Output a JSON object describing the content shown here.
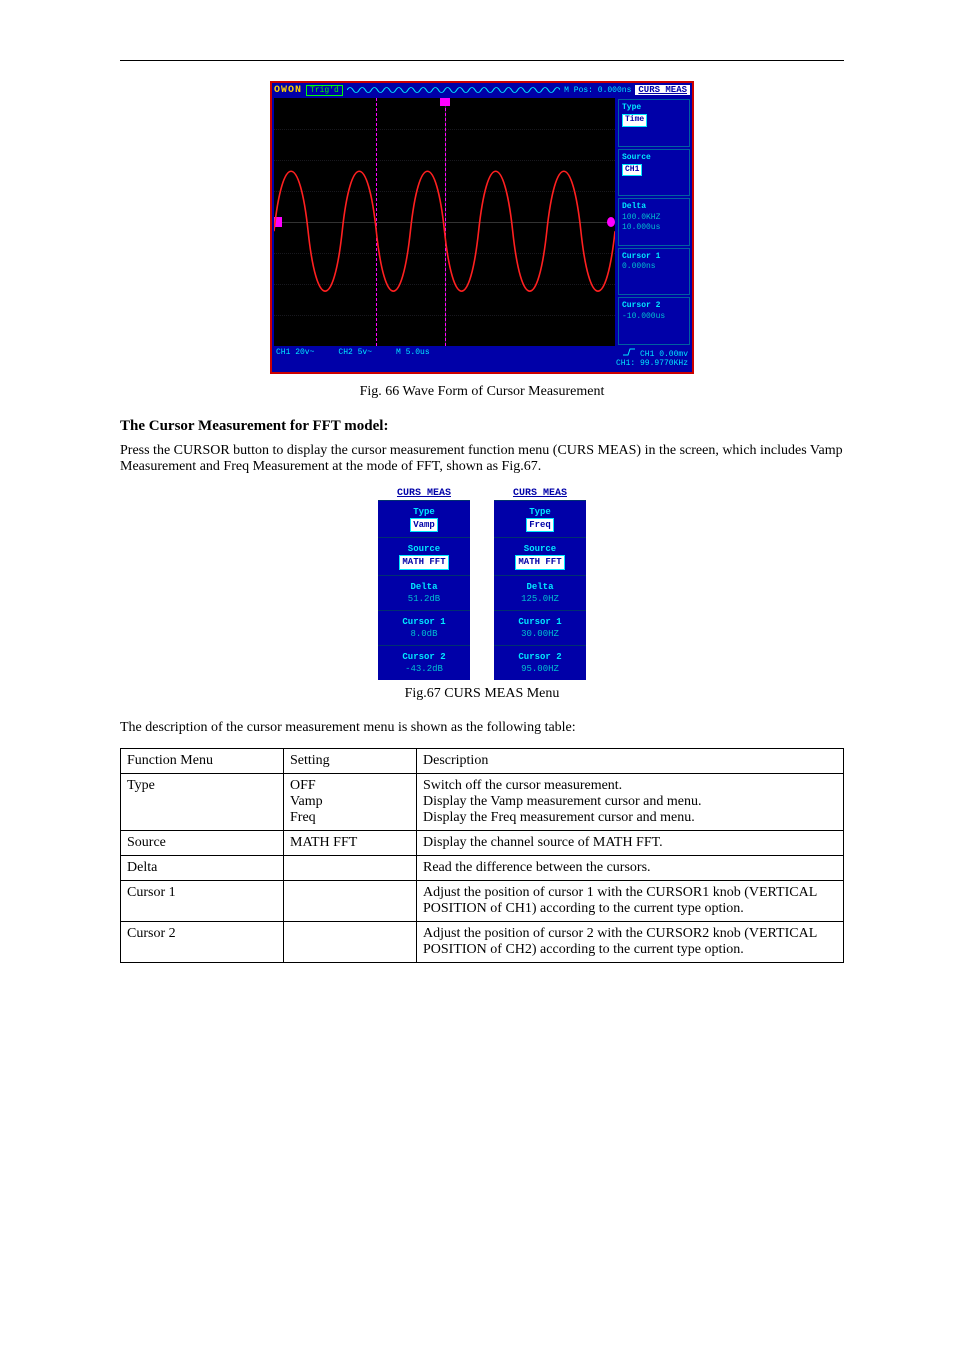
{
  "scope": {
    "brand": "OWON",
    "trig_status": "Trig'd",
    "m_pos": "M Pos: 0.000ns",
    "menu_title": "CURS MEAS",
    "menu": {
      "type_label": "Type",
      "type_value": "Time",
      "source_label": "Source",
      "source_value": "CH1",
      "delta_label": "Delta",
      "delta_v1": "100.0KHZ",
      "delta_v2": "10.000us",
      "c1_label": "Cursor 1",
      "c1_value": "0.000ns",
      "c2_label": "Cursor 2",
      "c2_value": "-10.000us"
    },
    "bottom": {
      "ch1": "CH1 20v~",
      "ch2": "CH2 5v~",
      "timebase": "M 5.0us",
      "trig": "CH1 0.00mv",
      "freq": "CH1: 99.9770KHz"
    }
  },
  "fig66": "Fig. 66 Wave Form of Cursor Measurement",
  "header1": "The Cursor Measurement for FFT model:",
  "para1": "Press the CURSOR button to display the cursor measurement function menu (CURS MEAS) in the screen, which includes Vamp Measurement and Freq Measurement at the mode of FFT, shown as Fig.67.",
  "twin": {
    "left": {
      "title": "CURS MEAS",
      "type_label": "Type",
      "type_value": "Vamp",
      "source_label": "Source",
      "source_value": "MATH FFT",
      "delta_label": "Delta",
      "delta_value": "51.2dB",
      "c1_label": "Cursor 1",
      "c1_value": "8.0dB",
      "c2_label": "Cursor 2",
      "c2_value": "-43.2dB"
    },
    "right": {
      "title": "CURS MEAS",
      "type_label": "Type",
      "type_value": "Freq",
      "source_label": "Source",
      "source_value": "MATH FFT",
      "delta_label": "Delta",
      "delta_value": "125.0HZ",
      "c1_label": "Cursor 1",
      "c1_value": "30.00HZ",
      "c2_label": "Cursor 2",
      "c2_value": "95.00HZ"
    }
  },
  "fig67": "Fig.67 CURS MEAS Menu",
  "para2": "The description of the cursor measurement menu is shown as the following table:",
  "table": {
    "h1": "Function Menu",
    "h2": "Setting",
    "h3": "Description",
    "rows": [
      {
        "c1": "Type",
        "c2": "OFF\nVamp\nFreq",
        "c3": "Switch off the cursor measurement.\nDisplay the Vamp measurement cursor and menu.\nDisplay the Freq measurement cursor and menu."
      },
      {
        "c1": "Source",
        "c2": "MATH FFT",
        "c3": "Display the channel source of MATH FFT."
      },
      {
        "c1": "Delta",
        "c2": "",
        "c3": "Read the difference between the cursors."
      },
      {
        "c1": "Cursor 1",
        "c2": "",
        "c3": "Adjust the position of cursor 1 with the CURSOR1 knob (VERTICAL POSITION of CH1) according to the current type option."
      },
      {
        "c1": "Cursor 2",
        "c2": "",
        "c3": "Adjust the position of cursor 2 with the CURSOR2 knob (VERTICAL POSITION of CH2) according to the current type option."
      }
    ]
  }
}
